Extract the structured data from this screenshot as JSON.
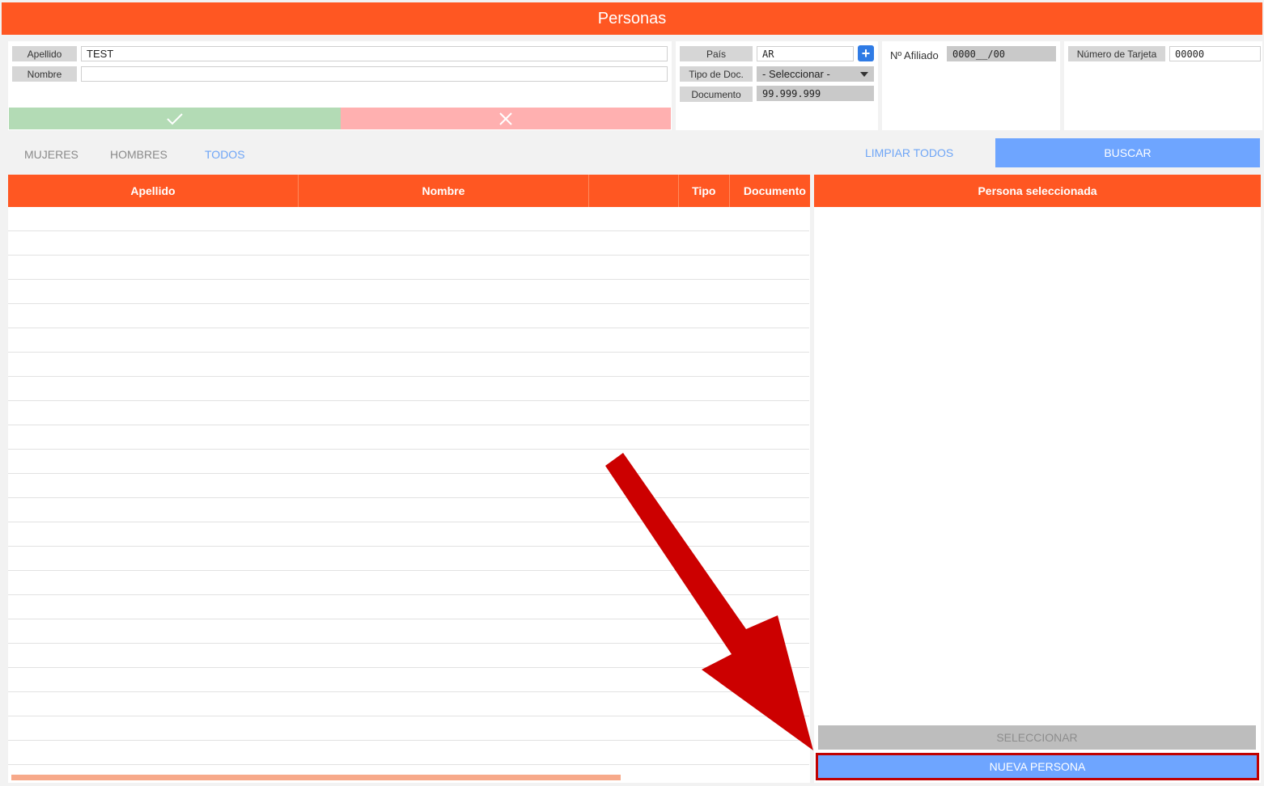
{
  "window": {
    "title": "Personas"
  },
  "filters": {
    "apellido_label": "Apellido",
    "apellido_value": "TEST",
    "nombre_label": "Nombre",
    "nombre_value": "",
    "pais_label": "País",
    "pais_value": "AR",
    "tipo_doc_label": "Tipo de Doc.",
    "tipo_doc_value": "- Seleccionar -",
    "documento_label": "Documento",
    "documento_value": "99.999.999",
    "afiliado_label": "Nº Afiliado",
    "afiliado_value": "0000__/00",
    "tarjeta_label": "Número de Tarjeta",
    "tarjeta_value": "00000",
    "add_symbol": "+"
  },
  "tabs": [
    {
      "label": "MUJERES",
      "active": false
    },
    {
      "label": "HOMBRES",
      "active": false
    },
    {
      "label": "TODOS",
      "active": true
    }
  ],
  "actions": {
    "clear_label": "LIMPIAR TODOS",
    "search_label": "BUSCAR"
  },
  "table": {
    "columns": [
      "Apellido",
      "Nombre",
      "",
      "Tipo",
      "Documento"
    ],
    "row_count": 23
  },
  "selected": {
    "title": "Persona seleccionada",
    "select_label": "SELECCIONAR",
    "new_label": "NUEVA PERSONA"
  },
  "colors": {
    "accent": "#ff5722",
    "primary": "#6ea5ff",
    "ok": "#b3dbb5",
    "cancel": "#ffb0b0",
    "annotation": "#cc0000"
  }
}
